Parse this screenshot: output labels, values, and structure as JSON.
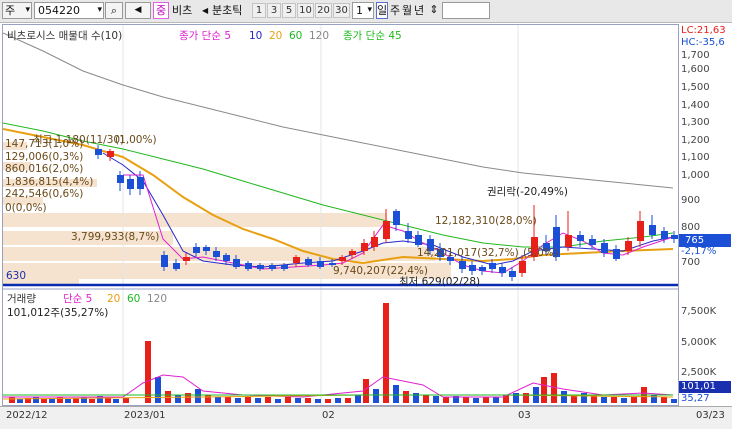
{
  "toolbar": {
    "market_label": "주",
    "code_value": "054220",
    "compare_label": "중",
    "stock_name": "비츠",
    "tick_label": "분초틱",
    "periods": [
      "1",
      "3",
      "5",
      "10",
      "20",
      "30"
    ],
    "count_value": "1",
    "day_label": "일",
    "week_label": "주",
    "month_label": "월",
    "year_label": "년",
    "dropdown_glyph": "▾",
    "updown_glyph": "⇕",
    "speaker_glyph": "◀",
    "search_glyph": "⌕"
  },
  "legend": {
    "title": "비츠로시스 매물대 수(10)",
    "ma_label": "종가 단순 5",
    "ma_10": "10",
    "ma_20": "20",
    "ma_60": "60",
    "ma_120": "120",
    "ma2_label": "종가 단순 45"
  },
  "volume_legend": {
    "title": "거래량",
    "ma_label": "단순 5",
    "ma_20": "20",
    "ma_60": "60",
    "ma_120": "120",
    "current": "101,012주(35,27%)"
  },
  "price_labels": {
    "lc": "LC:21,63",
    "hc": "HC:-35,6",
    "current_price": "765",
    "change_pct": "-2,17%",
    "min_price_label": "630"
  },
  "annotations": {
    "overlap_a": "147,713(1,0%)",
    "overlap_b": "최고 1,180(11/30)",
    "overlap_c": "(1,00%)",
    "v1": "129,006(0,3%)",
    "v2": "860,016(2,0%)",
    "v3": "1,836,815(4,4%)",
    "v4": "242,546(0,6%)",
    "v5": "0(0,0%)",
    "v6": "3,799,933(8,7%)",
    "v7": "9,740,207(22,4%)",
    "v8": "12,182,310(28,0%)",
    "v9": "14,201,017(32,7%)",
    "v9b": "(5,0%)",
    "v10": "최저 629(02/28)",
    "rights": "권리락(-20,49%)"
  },
  "y_axis_price": [
    "1,700",
    "1,600",
    "1,500",
    "1,400",
    "1,300",
    "1,200",
    "1,100",
    "1,000",
    "900",
    "800",
    "700"
  ],
  "y_axis_volume": [
    "7,500K",
    "5,000K",
    "2,500K"
  ],
  "y_axis_volume_current": "101,01",
  "y_axis_volume_pct": "35,27",
  "x_axis": [
    "2022/12",
    "2023/01",
    "02",
    "03",
    "03/23"
  ],
  "colors": {
    "up": "#e8201a",
    "down": "#1a4fd6",
    "ma5": "#e020d0",
    "ma10": "#2828c8",
    "ma20": "#e8a010",
    "ma60": "#20b820",
    "ma120": "#808080",
    "profile": "#f5e3cf",
    "min_line": "#0a2ab0"
  }
}
